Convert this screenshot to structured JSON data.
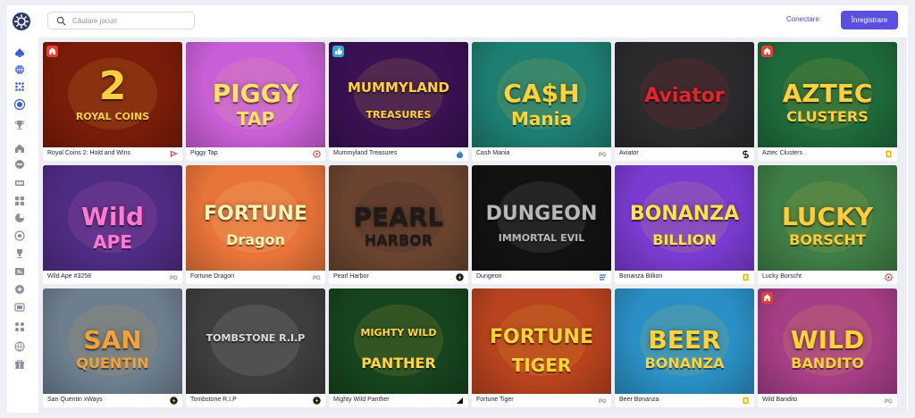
{
  "header": {
    "search_placeholder": "Căutare jocuri",
    "login_label": "Conectare",
    "register_label": "Înregistrare"
  },
  "sidebar": {
    "icons": [
      "spade-icon",
      "basketball-icon",
      "dice-grid-icon",
      "chip-icon",
      "trophy-icon",
      "home-icon",
      "minus-circle-icon",
      "slots-icon",
      "grid-icon",
      "pie-icon",
      "ball-icon",
      "cup-icon",
      "promo-icon",
      "plus-icon",
      "tv-icon",
      "apps-icon",
      "globe-icon",
      "gift-icon"
    ]
  },
  "games": [
    {
      "name": "Royal Coins 2: Hold and Wins",
      "art": "2",
      "sub": "ROYAL COINS",
      "bg": "#7a1d08",
      "fg": "#ffcf3f",
      "provider_icon": "play-flag-icon",
      "provider_color": "#e23a2b",
      "badge": "hot"
    },
    {
      "name": "Piggy Tap",
      "art": "PIGGY",
      "sub": "TAP",
      "bg": "#c95fd6",
      "fg": "#ffe168",
      "provider_icon": "target-icon",
      "provider_color": "#e2413a",
      "badge": ""
    },
    {
      "name": "Mummyland Treasures",
      "art": "MUMMYLAND",
      "sub": "TREASURES",
      "bg": "#3a1152",
      "fg": "#ffd23d",
      "provider_icon": "flame-icon",
      "provider_color": "#2f7fd0",
      "badge": "thumb"
    },
    {
      "name": "Cash Mania",
      "art": "CA$H",
      "sub": "Mania",
      "bg": "#1e7e72",
      "fg": "#ffd23a",
      "provider_icon": "pg-icon",
      "provider_color": "#888888",
      "badge": ""
    },
    {
      "name": "Aviator",
      "art": "Aviator",
      "sub": "",
      "bg": "#2b2b2e",
      "fg": "#e3262e",
      "provider_icon": "spribe-icon",
      "provider_color": "#111111",
      "badge": ""
    },
    {
      "name": "Aztec Clusters",
      "art": "AZTEC",
      "sub": "CLUSTERS",
      "bg": "#1f6a3a",
      "fg": "#ffcf3f",
      "provider_icon": "bgaming-icon",
      "provider_color": "#e6b400",
      "badge": "hot"
    },
    {
      "name": "Wild Ape #3258",
      "art": "Wild",
      "sub": "APE",
      "bg": "#4f2c84",
      "fg": "#ff7ad0",
      "provider_icon": "pg-icon",
      "provider_color": "#888888",
      "badge": ""
    },
    {
      "name": "Fortune Dragon",
      "art": "FORTUNE",
      "sub": "Dragon",
      "bg": "#e8743a",
      "fg": "#fff3b5",
      "provider_icon": "pg-icon",
      "provider_color": "#888888",
      "badge": ""
    },
    {
      "name": "Pearl Harbor",
      "art": "PEARL",
      "sub": "HARBOR",
      "bg": "#6a4430",
      "fg": "#1e1a17",
      "provider_icon": "bolt-icon",
      "provider_color": "#1b1b1b",
      "badge": ""
    },
    {
      "name": "Dungeon",
      "art": "DUNGEON",
      "sub": "IMMORTAL EVIL",
      "bg": "#121212",
      "fg": "#b8b8b8",
      "provider_icon": "stripes-icon",
      "provider_color": "#2a6ad8",
      "badge": ""
    },
    {
      "name": "Bonanza Billion",
      "art": "BONANZA",
      "sub": "BILLION",
      "bg": "#7a3bd0",
      "fg": "#ffe14a",
      "provider_icon": "bgaming-icon",
      "provider_color": "#e6b400",
      "badge": ""
    },
    {
      "name": "Lucky Borscht",
      "art": "LUCKY",
      "sub": "BORSCHT",
      "bg": "#3f7d46",
      "fg": "#ffcc3a",
      "provider_icon": "target-icon",
      "provider_color": "#e2413a",
      "badge": ""
    },
    {
      "name": "San Quentin xWays",
      "art": "SAN",
      "sub": "QUENTIN",
      "bg": "#6d7f8e",
      "fg": "#f3a23a",
      "provider_icon": "bolt-icon",
      "provider_color": "#1b1b1b",
      "badge": ""
    },
    {
      "name": "Tombstone R.I.P",
      "art": "TOMBSTONE R.I.P",
      "sub": "",
      "bg": "#3e3e3e",
      "fg": "#dcdcdc",
      "provider_icon": "bolt-icon",
      "provider_color": "#1b1b1b",
      "badge": ""
    },
    {
      "name": "Mighty Wild Panther",
      "art": "MIGHTY WILD",
      "sub": "PANTHER",
      "bg": "#16441e",
      "fg": "#ffd54a",
      "provider_icon": "corner-icon",
      "provider_color": "#111111",
      "badge": ""
    },
    {
      "name": "Fortune Tiger",
      "art": "FORTUNE",
      "sub": "TIGER",
      "bg": "#b8431e",
      "fg": "#ffd23a",
      "provider_icon": "pg-icon",
      "provider_color": "#888888",
      "badge": ""
    },
    {
      "name": "Beer Bonanza",
      "art": "BEER",
      "sub": "BONANZA",
      "bg": "#2a8fc4",
      "fg": "#ffd23a",
      "provider_icon": "bgaming-icon",
      "provider_color": "#e6b400",
      "badge": ""
    },
    {
      "name": "Wild Bandito",
      "art": "WILD",
      "sub": "BANDITO",
      "bg": "#a53e86",
      "fg": "#ffd23a",
      "provider_icon": "pg-icon",
      "provider_color": "#888888",
      "badge": "hot"
    }
  ],
  "colors": {
    "accent": "#5a4fe0",
    "link": "#4a47d6",
    "hot_badge": "#e2413a",
    "thumb_badge": "#3aa2d8"
  }
}
